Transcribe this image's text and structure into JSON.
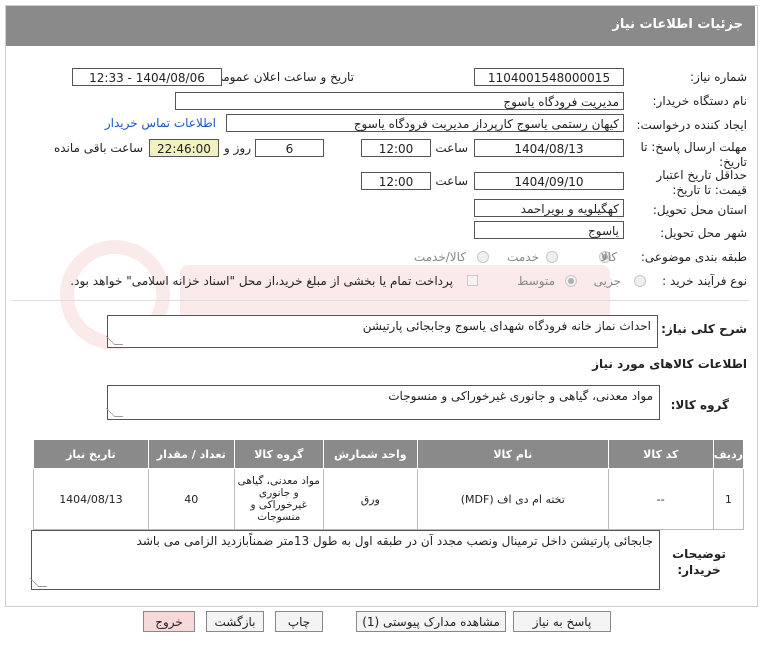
{
  "header": {
    "title": "جزئیات اطلاعات نیاز"
  },
  "fields": {
    "need_number_label": "شماره نیاز:",
    "need_number": "1104001548000015",
    "announce_label": "تاریخ و ساعت اعلان عمومی:",
    "announce_value": "1404/08/06 - 12:33",
    "buyer_label": "نام دستگاه خریدار:",
    "buyer_value": "مدیریت فرودگاه یاسوج",
    "creator_label": "ایجاد کننده درخواست:",
    "creator_value": "کیهان رستمی یاسوج کارپرداز مدیریت فرودگاه یاسوج",
    "contact_link": "اطلاعات تماس خریدار",
    "deadline_label": "مهلت ارسال پاسخ: تا تاریخ:",
    "deadline_date": "1404/08/13",
    "time_label": "ساعت",
    "deadline_time": "12:00",
    "days_value": "6",
    "days_label": "روز و",
    "remaining_time": "22:46:00",
    "remaining_label": "ساعت باقی مانده",
    "validity_label": "حداقل تاریخ اعتبار قیمت: تا تاریخ:",
    "validity_date": "1404/09/10",
    "validity_time": "12:00",
    "province_label": "استان محل تحویل:",
    "province_value": "کهگیلویه و بویراحمد",
    "city_label": "شهر محل تحویل:",
    "city_value": "یاسوج",
    "category_label": "طبقه بندی موضوعی:",
    "category_options": [
      "کالا",
      "خدمت",
      "کالا/خدمت"
    ],
    "process_label": "نوع فرآیند خرید :",
    "process_options": [
      "جزیی",
      "متوسط"
    ],
    "payment_note": "پرداخت تمام یا بخشی از مبلغ خرید،از محل \"اسناد خزانه اسلامی\" خواهد بود."
  },
  "summary": {
    "label": "شرح کلی نیاز:",
    "value": "احداث نماز خانه فرودگاه شهدای یاسوج وجابجائی پارتیشن"
  },
  "goods": {
    "section_title": "اطلاعات کالاهای مورد نیاز",
    "group_label": "گروه کالا:",
    "group_value": "مواد معدنی، گیاهی و جانوری غیرخوراکی و منسوجات"
  },
  "table": {
    "headers": [
      "ردیف",
      "کد کالا",
      "نام کالا",
      "واحد شمارش",
      "گروه کالا",
      "تعداد / مقدار",
      "تاریخ نیاز"
    ],
    "rows": [
      [
        "1",
        "--",
        "تخته ام دی اف (MDF)",
        "ورق",
        "مواد معدنی، گیاهی و جانوری غیرخوراکی و منسوجات",
        "40",
        "1404/08/13"
      ]
    ]
  },
  "notes": {
    "label": "توضیحات خریدار:",
    "value": "جابجائی پارتیشن داخل ترمینال ونصب مجدد آن در طبقه اول به طول 13متر ضمناًبازدید الزامی می باشد"
  },
  "buttons": {
    "reply": "پاسخ به نیاز",
    "attachments": "مشاهده مدارک پیوستی (1)",
    "print": "چاپ",
    "back": "بازگشت",
    "exit": "خروج"
  },
  "colors": {
    "header_bg": "#8a8a8a",
    "link": "#1a56c7",
    "highlight": "#f0f0c0",
    "exit_bg": "#f8d8d8"
  }
}
